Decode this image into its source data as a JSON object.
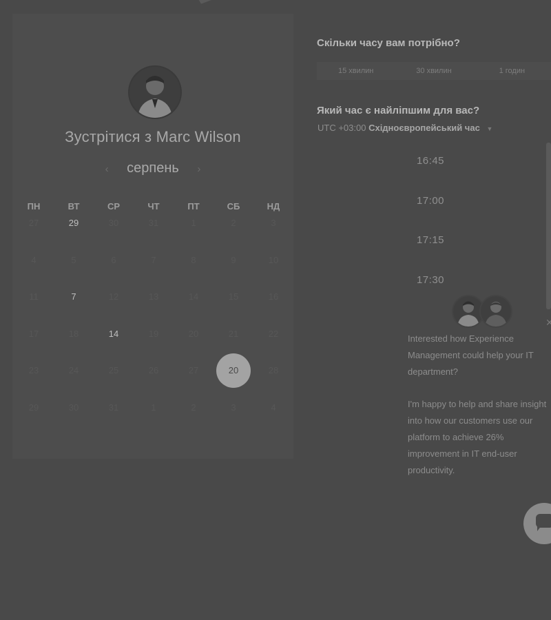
{
  "calendar": {
    "title": "Зустрітися з Marc Wilson",
    "month": "серпень",
    "weekdays": [
      "ПН",
      "ВТ",
      "СР",
      "ЧТ",
      "ПТ",
      "СБ",
      "НД"
    ],
    "weeks": [
      [
        {
          "d": "27",
          "a": false
        },
        {
          "d": "29",
          "a": true
        },
        {
          "d": "30",
          "a": false
        },
        {
          "d": "31",
          "a": false
        },
        {
          "d": "1",
          "a": false
        },
        {
          "d": "2",
          "a": false
        },
        {
          "d": "3",
          "a": false
        }
      ],
      [
        {
          "d": "4",
          "a": false
        },
        {
          "d": "5",
          "a": false
        },
        {
          "d": "6",
          "a": false
        },
        {
          "d": "7",
          "a": false
        },
        {
          "d": "8",
          "a": false
        },
        {
          "d": "9",
          "a": false
        },
        {
          "d": "10",
          "a": false
        }
      ],
      [
        {
          "d": "11",
          "a": false
        },
        {
          "d": "7",
          "a": true
        },
        {
          "d": "12",
          "a": false
        },
        {
          "d": "13",
          "a": false
        },
        {
          "d": "14",
          "a": false
        },
        {
          "d": "15",
          "a": false
        },
        {
          "d": "16",
          "a": false
        }
      ],
      [
        {
          "d": "17",
          "a": false
        },
        {
          "d": "18",
          "a": false
        },
        {
          "d": "14",
          "a": true
        },
        {
          "d": "19",
          "a": false
        },
        {
          "d": "20",
          "a": false
        },
        {
          "d": "21",
          "a": false
        },
        {
          "d": "22",
          "a": false
        }
      ],
      [
        {
          "d": "23",
          "a": false
        },
        {
          "d": "24",
          "a": false
        },
        {
          "d": "25",
          "a": false
        },
        {
          "d": "26",
          "a": false
        },
        {
          "d": "27",
          "a": false
        },
        {
          "d": "20",
          "a": true,
          "sel": true
        },
        {
          "d": "28",
          "a": false
        }
      ],
      [
        {
          "d": "29",
          "a": false
        },
        {
          "d": "30",
          "a": false
        },
        {
          "d": "31",
          "a": false
        },
        {
          "d": "1",
          "a": false
        },
        {
          "d": "2",
          "a": false
        },
        {
          "d": "3",
          "a": false
        },
        {
          "d": "4",
          "a": false
        }
      ]
    ]
  },
  "duration": {
    "question": "Скільки часу вам потрібно?",
    "options": [
      "15 хвилин",
      "30 хвилин",
      "1 годин"
    ]
  },
  "timepick": {
    "question": "Який час є найліпшим для вас?",
    "tz_offset": "UTC +03:00",
    "tz_name": "Східноєвропейський час",
    "slots": [
      "16:45",
      "17:00",
      "17:15",
      "17:30"
    ]
  },
  "chat": {
    "message1": "Interested how Experience Management could help your IT department?",
    "message2": "I'm happy to help and share insight into how our customers use our platform to achieve 26% improvement in IT end-user productivity.",
    "close_glyph": "✕"
  },
  "icons": {
    "prev": "‹",
    "next": "›",
    "caret": "▼"
  }
}
